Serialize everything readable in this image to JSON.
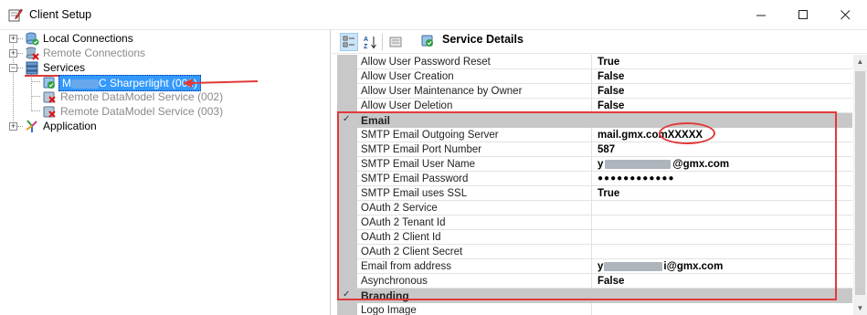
{
  "window": {
    "title": "Client Setup",
    "icons": {
      "app": "settings-pencil-icon",
      "minimize": "minimize-icon",
      "maximize": "maximize-icon",
      "close": "close-icon"
    }
  },
  "tree": {
    "items": [
      {
        "label": "Local Connections",
        "icon": "database-check-icon",
        "dim": false,
        "expander": "+"
      },
      {
        "label": "Remote Connections",
        "icon": "database-x-icon",
        "dim": true,
        "expander": "+"
      },
      {
        "label": "Services",
        "icon": "server-icon",
        "dim": false,
        "expander": "−"
      },
      {
        "label": "C Sharperlight (001)",
        "label_prefix": "M",
        "icon": "service-check-icon",
        "dim": false,
        "selected": true
      },
      {
        "label": "Remote DataModel Service (002)",
        "icon": "service-x-icon",
        "dim": true
      },
      {
        "label": "Remote DataModel Service (003)",
        "icon": "service-x-icon",
        "dim": true
      },
      {
        "label": "Application",
        "icon": "application-icon",
        "dim": false,
        "expander": "+"
      }
    ]
  },
  "toolbar": {
    "categorized_icon": "categorized-icon",
    "alphabetical_icon": "sort-az-icon",
    "property_pages_icon": "property-pages-icon",
    "heading": "Service Details",
    "heading_icon": "service-check-icon"
  },
  "grid": {
    "rows": [
      {
        "type": "prop",
        "name": "Allow User Password Reset",
        "value": "True"
      },
      {
        "type": "prop",
        "name": "Allow User Creation",
        "value": "False"
      },
      {
        "type": "prop",
        "name": "Allow User Maintenance by Owner",
        "value": "False"
      },
      {
        "type": "prop",
        "name": "Allow User Deletion",
        "value": "False"
      },
      {
        "type": "cat",
        "name": "Email"
      },
      {
        "type": "prop",
        "name": "SMTP Email Outgoing Server",
        "value": "mail.gmx.comXXXXX"
      },
      {
        "type": "prop",
        "name": "SMTP Email Port Number",
        "value": "587"
      },
      {
        "type": "prop",
        "name": "SMTP Email User Name",
        "value_prefix": "y",
        "value": "@gmx.com",
        "masked": true
      },
      {
        "type": "prop",
        "name": "SMTP Email Password",
        "value": "●●●●●●●●●●●●"
      },
      {
        "type": "prop",
        "name": "SMTP Email uses SSL",
        "value": "True"
      },
      {
        "type": "prop",
        "name": "OAuth 2 Service",
        "value": ""
      },
      {
        "type": "prop",
        "name": "OAuth 2 Tenant Id",
        "value": ""
      },
      {
        "type": "prop",
        "name": "OAuth 2 Client Id",
        "value": ""
      },
      {
        "type": "prop",
        "name": "OAuth 2 Client Secret",
        "value": ""
      },
      {
        "type": "prop",
        "name": "Email from address",
        "value_prefix": "y",
        "value": "i@gmx.com",
        "masked": true
      },
      {
        "type": "prop",
        "name": "Asynchronous",
        "value": "False"
      },
      {
        "type": "cat",
        "name": "Branding"
      },
      {
        "type": "prop",
        "name": "Logo Image",
        "value": ""
      }
    ]
  },
  "annotation_color": "#e03a3a"
}
